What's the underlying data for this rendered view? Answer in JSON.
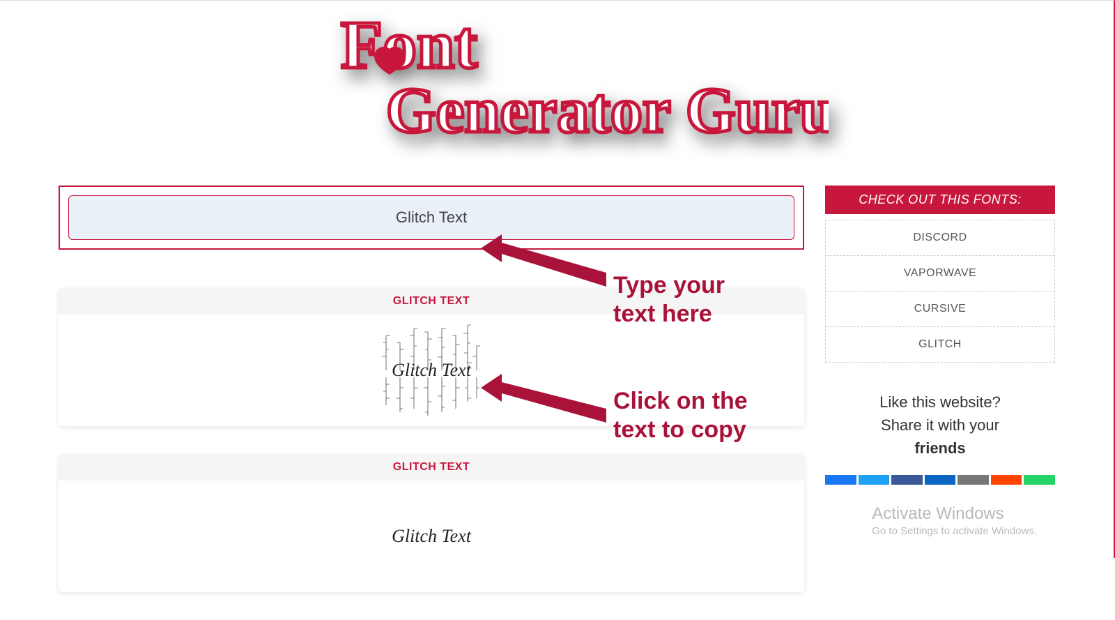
{
  "logo": {
    "word1": "Font",
    "word2": "Generator Guru"
  },
  "input": {
    "value": "Glitch Text",
    "placeholder": ""
  },
  "results": [
    {
      "title": "GLITCH TEXT",
      "rendered": "Glitch Text"
    },
    {
      "title": "GLITCH TEXT",
      "rendered": "Glitch Text"
    }
  ],
  "sidebar": {
    "title": "CHECK OUT THIS FONTS:",
    "items": [
      "DISCORD",
      "VAPORWAVE",
      "CURSIVE",
      "GLITCH"
    ]
  },
  "share": {
    "line1": "Like this website?",
    "line2a": "Share it with your",
    "line2b": "friends",
    "buttons": [
      "#1877f2",
      "#1da1f2",
      "#3b5998",
      "#0a66c2",
      "#777777",
      "#ff4500",
      "#25d366"
    ]
  },
  "annotations": {
    "type_here": "Type your\ntext here",
    "click_copy": "Click on the\ntext to copy"
  },
  "watermark": {
    "title": "Activate Windows",
    "sub": "Go to Settings to activate Windows."
  },
  "colors": {
    "accent": "#c8173c"
  }
}
